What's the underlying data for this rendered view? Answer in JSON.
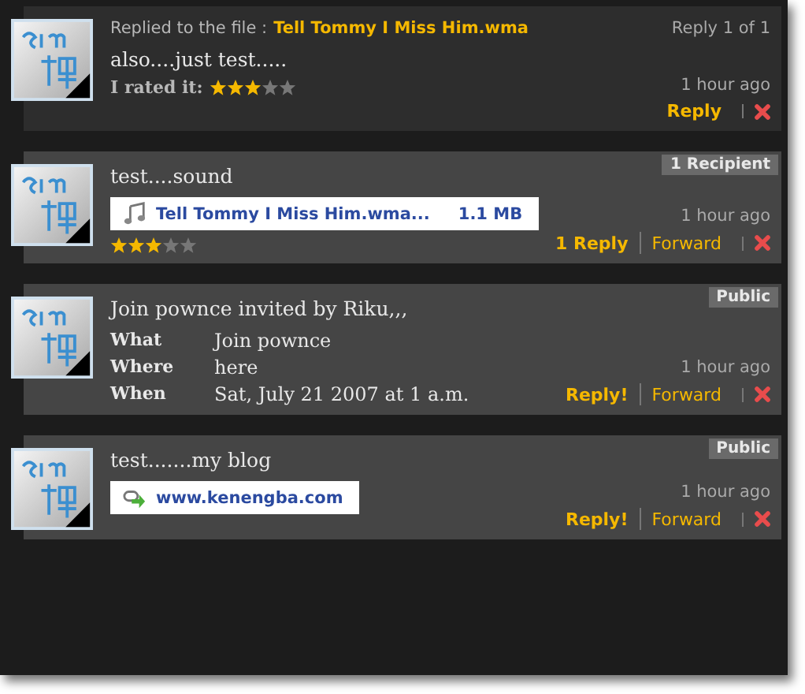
{
  "posts": [
    {
      "kind": "reply",
      "replied_label": "Replied to the file :",
      "replied_file": "Tell Tommy I Miss Him.wma",
      "counter": "Reply 1 of 1",
      "text": "also....just test.....",
      "rating_label": "I rated it:",
      "stars": 3,
      "time": "1 hour ago",
      "actions": [
        {
          "kind": "reply",
          "label": "Reply"
        }
      ]
    },
    {
      "kind": "message",
      "badge": "1 Recipient",
      "text": "test....sound",
      "attachment": {
        "kind": "file",
        "name": "Tell Tommy I Miss Him.wma...",
        "size": "1.1 MB"
      },
      "stars": 3,
      "time": "1 hour ago",
      "actions": [
        {
          "kind": "reply",
          "label": "1 Reply"
        },
        {
          "kind": "forward",
          "label": "Forward"
        }
      ]
    },
    {
      "kind": "message",
      "badge": "Public",
      "text": "Join pownce invited by Riku,,,",
      "details": [
        {
          "label": "What",
          "value": "Join pownce"
        },
        {
          "label": "Where",
          "value": "here"
        },
        {
          "label": "When",
          "value": "Sat, July 21 2007 at 1 a.m."
        }
      ],
      "time": "1 hour ago",
      "actions": [
        {
          "kind": "reply",
          "label": "Reply!"
        },
        {
          "kind": "forward",
          "label": "Forward"
        }
      ]
    },
    {
      "kind": "message",
      "badge": "Public",
      "text": "test.......my blog",
      "attachment": {
        "kind": "link",
        "name": "www.kenengba.com"
      },
      "time": "1 hour ago",
      "actions": [
        {
          "kind": "reply",
          "label": "Reply!"
        },
        {
          "kind": "forward",
          "label": "Forward"
        }
      ]
    }
  ]
}
